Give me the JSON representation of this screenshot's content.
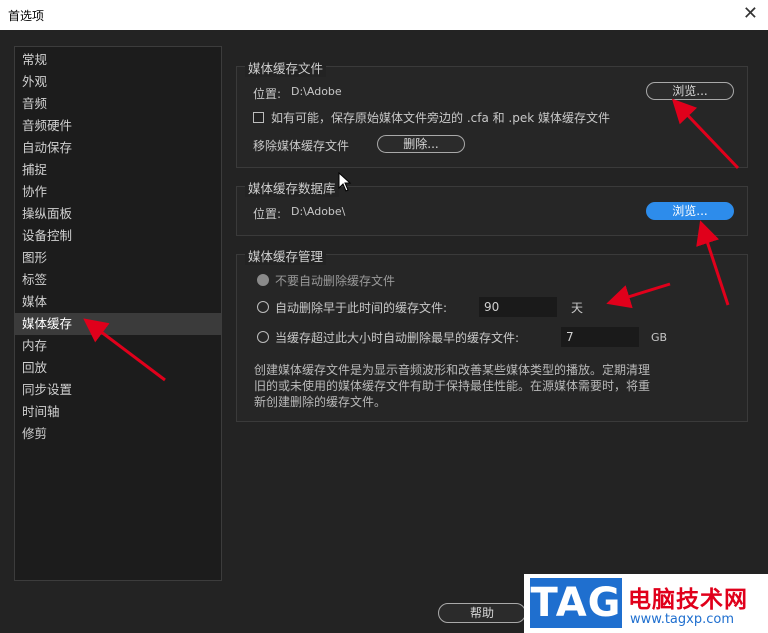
{
  "window": {
    "title": "首选项"
  },
  "sidebar": {
    "items": [
      "常规",
      "外观",
      "音频",
      "音频硬件",
      "自动保存",
      "捕捉",
      "协作",
      "操纵面板",
      "设备控制",
      "图形",
      "标签",
      "媒体",
      "媒体缓存",
      "内存",
      "回放",
      "同步设置",
      "时间轴",
      "修剪"
    ],
    "selected": "媒体缓存"
  },
  "media_cache_files": {
    "title": "媒体缓存文件",
    "location_label": "位置:",
    "location_value": "D:\\Adobe",
    "browse_label": "浏览...",
    "checkbox_label": "如有可能，保存原始媒体文件旁边的 .cfa 和 .pek 媒体缓存文件",
    "remove_label": "移除媒体缓存文件",
    "delete_label": "删除..."
  },
  "media_cache_db": {
    "title": "媒体缓存数据库",
    "location_label": "位置:",
    "location_value": "D:\\Adobe\\",
    "browse_label": "浏览..."
  },
  "cache_management": {
    "title": "媒体缓存管理",
    "opt_no_auto": "不要自动删除缓存文件",
    "opt_older_than": "自动删除早于此时间的缓存文件:",
    "older_value": "90",
    "older_unit": "天",
    "opt_exceeds": "当缓存超过此大小时自动删除最早的缓存文件:",
    "size_value": "7",
    "size_unit": "GB",
    "description": "创建媒体缓存文件是为显示音频波形和改善某些媒体类型的播放。定期清理旧的或未使用的媒体缓存文件有助于保持最佳性能。在源媒体需要时，将重新创建删除的缓存文件。"
  },
  "footer": {
    "help_label": "帮助"
  },
  "watermark": {
    "logo": "TAG",
    "title": "电脑技术网",
    "url": "www.tagxp.com"
  },
  "colors": {
    "accent": "#2d8ceb",
    "annotation": "#e0001b"
  }
}
